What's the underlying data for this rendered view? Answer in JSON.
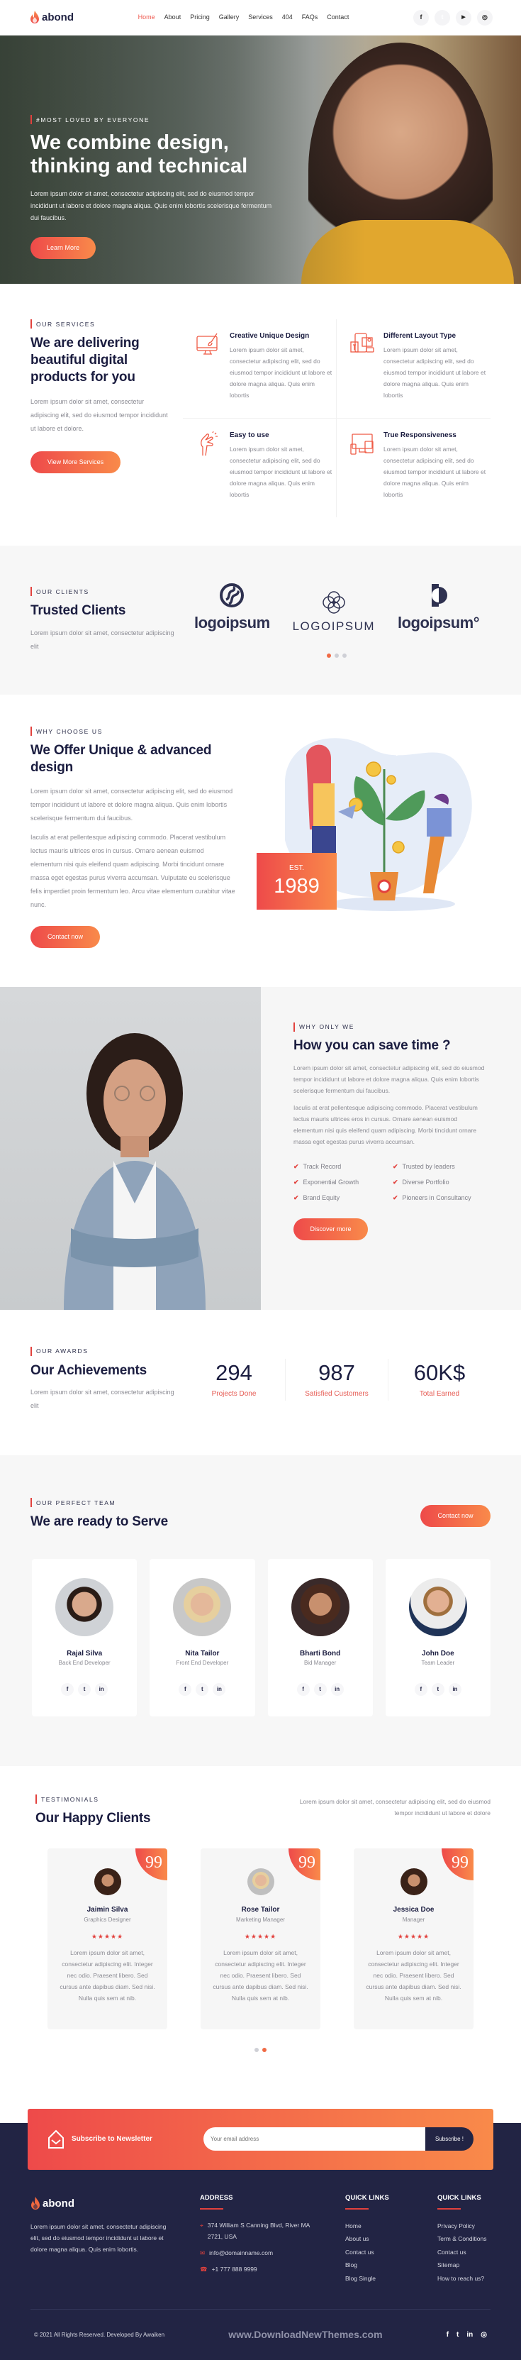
{
  "header": {
    "brand": "abond",
    "nav": [
      "Home",
      "About",
      "Pricing",
      "Gallery",
      "Services",
      "404",
      "FAQs",
      "Contact"
    ],
    "social_icons": [
      "facebook-icon",
      "twitter-icon",
      "youtube-icon",
      "instagram-icon"
    ],
    "social_glyphs": [
      "f",
      "t",
      "▶",
      "◎"
    ]
  },
  "hero": {
    "eyebrow": "#MOST LOVED BY EVERYONE",
    "title_line1": "We combine design,",
    "title_line2": "thinking and technical",
    "text": "Lorem ipsum dolor sit amet, consectetur adipiscing elit, sed do eiusmod tempor incididunt ut labore et dolore magna aliqua. Quis enim lobortis scelerisque fermentum dui faucibus.",
    "button": "Learn More"
  },
  "services": {
    "eyebrow": "OUR SERVICES",
    "title": "We are delivering beautiful digital products for you",
    "text": "Lorem ipsum dolor sit amet, consectetur adipiscing elit, sed do eiusmod tempor incididunt ut labore et dolore.",
    "button": "View More Services",
    "items": [
      {
        "title": "Creative Unique Design",
        "text": "Lorem ipsum dolor sit amet, consectetur adipiscing elit, sed do eiusmod tempor incididunt ut labore et dolore magna aliqua. Quis enim lobortis"
      },
      {
        "title": "Different Layout Type",
        "text": "Lorem ipsum dolor sit amet, consectetur adipiscing elit, sed do eiusmod tempor incididunt ut labore et dolore magna aliqua. Quis enim lobortis"
      },
      {
        "title": "Easy to use",
        "text": "Lorem ipsum dolor sit amet, consectetur adipiscing elit, sed do eiusmod tempor incididunt ut labore et dolore magna aliqua. Quis enim lobortis"
      },
      {
        "title": "True Responsiveness",
        "text": "Lorem ipsum dolor sit amet, consectetur adipiscing elit, sed do eiusmod tempor incididunt ut labore et dolore magna aliqua. Quis enim lobortis"
      }
    ]
  },
  "clients": {
    "eyebrow": "OUR CLIENTS",
    "title": "Trusted Clients",
    "text": "Lorem ipsum dolor sit amet, consectetur adipiscing elit",
    "logos": [
      "logoipsum",
      "LOGOIPSUM",
      "logoipsum°"
    ],
    "active_slide": 1,
    "slide_count": 3
  },
  "why": {
    "eyebrow": "WHY CHOOSE US",
    "title": "We Offer Unique & advanced design",
    "text1": "Lorem ipsum dolor sit amet, consectetur adipiscing elit, sed do eiusmod tempor incididunt ut labore et dolore magna aliqua. Quis enim lobortis scelerisque fermentum dui faucibus.",
    "text2": "Iaculis at erat pellentesque adipiscing commodo. Placerat vestibulum lectus mauris ultrices eros in cursus. Ornare aenean euismod elementum nisi quis eleifend quam adipiscing. Morbi tincidunt ornare massa eget egestas purus viverra accumsan. Vulputate eu scelerisque felis imperdiet proin fermentum leo. Arcu vitae elementum curabitur vitae nunc.",
    "button": "Contact now",
    "est_label": "EST.",
    "est_year": "1989"
  },
  "save": {
    "eyebrow": "WHY ONLY WE",
    "title": "How you can save time ?",
    "text1": "Lorem ipsum dolor sit amet, consectetur adipiscing elit, sed do eiusmod tempor incididunt ut labore et dolore magna aliqua. Quis enim lobortis scelerisque fermentum dui faucibus.",
    "text2": "Iaculis at erat pellentesque adipiscing commodo. Placerat vestibulum lectus mauris ultrices eros in cursus. Ornare aenean euismod elementum nisi quis eleifend quam adipiscing. Morbi tincidunt ornare massa eget egestas purus viverra accumsan.",
    "checks": [
      "Track Record",
      "Trusted by leaders",
      "Exponential Growth",
      "Diverse Portfolio",
      "Brand Equity",
      "Pioneers in Consultancy"
    ],
    "button": "Discover more"
  },
  "achievements": {
    "eyebrow": "OUR AWARDS",
    "title": "Our Achievements",
    "text": "Lorem ipsum dolor sit amet, consectetur adipiscing elit",
    "stats": [
      {
        "value": "294",
        "label": "Projects Done"
      },
      {
        "value": "987",
        "label": "Satisfied Customers"
      },
      {
        "value": "60K$",
        "label": "Total Earned"
      }
    ]
  },
  "team": {
    "eyebrow": "OUR PERFECT TEAM",
    "title": "We are ready to Serve",
    "button": "Contact now",
    "members": [
      {
        "name": "Rajal Silva",
        "role": "Back End Developer"
      },
      {
        "name": "Nita Tailor",
        "role": "Front End Developer"
      },
      {
        "name": "Bharti Bond",
        "role": "Bid Manager"
      },
      {
        "name": "John Doe",
        "role": "Team Leader"
      }
    ],
    "social_glyphs": [
      "f",
      "t",
      "in"
    ]
  },
  "testimonials": {
    "eyebrow": "TESTIMONIALS",
    "title": "Our Happy Clients",
    "text": "Lorem ipsum dolor sit amet, consectetur adipiscing elit, sed do eiusmod tempor incididunt ut labore et dolore",
    "quote_glyph": "99",
    "items": [
      {
        "name": "Jaimin Silva",
        "role": "Graphics Designer",
        "rating": 5,
        "stars": "★★★★★",
        "text": "Lorem ipsum dolor sit amet, consectetur adipiscing elit. Integer nec odio. Praesent libero. Sed cursus ante dapibus diam. Sed nisi. Nulla quis sem at nib."
      },
      {
        "name": "Rose Tailor",
        "role": "Marketing Manager",
        "rating": 5,
        "stars": "★★★★★",
        "text": "Lorem ipsum dolor sit amet, consectetur adipiscing elit. Integer nec odio. Praesent libero. Sed cursus ante dapibus diam. Sed nisi. Nulla quis sem at nib."
      },
      {
        "name": "Jessica Doe",
        "role": "Manager",
        "rating": 5,
        "stars": "★★★★★",
        "text": "Lorem ipsum dolor sit amet, consectetur adipiscing elit. Integer nec odio. Praesent libero. Sed cursus ante dapibus diam. Sed nisi. Nulla quis sem at nib."
      }
    ],
    "active_slide": 2,
    "slide_count": 2
  },
  "newsletter": {
    "title": "Subscribe to Newsletter",
    "placeholder": "Your email address",
    "button": "Subscribe !"
  },
  "footer": {
    "brand": "abond",
    "about": "Lorem ipsum dolor sit amet, consectetur adipiscing elit, sed do eiusmod tempor incididunt ut labore et dolore magna aliqua. Quis enim lobortis.",
    "address_title": "ADDRESS",
    "address": "374 William S Canning Blvd, River MA 2721, USA",
    "email": "info@domainname.com",
    "phone": "+1 777 888 9999",
    "links1_title": "QUICK LINKS",
    "links1": [
      "Home",
      "About us",
      "Contact us",
      "Blog",
      "Blog Single"
    ],
    "links2_title": "QUICK LINKS",
    "links2": [
      "Privacy Policy",
      "Term & Conditions",
      "Contact us",
      "Sitemap",
      "How to reach us?"
    ],
    "copyright": "© 2021 All Rights Reserved. Developed By Awaiken",
    "watermark": "www.DownloadNewThemes.com",
    "social_glyphs": [
      "f",
      "t",
      "in",
      "◎"
    ]
  },
  "colors": {
    "accent_start": "#ee4a4a",
    "accent_end": "#f98a4a",
    "navy": "#222444",
    "text_dark": "#1b1d40"
  }
}
